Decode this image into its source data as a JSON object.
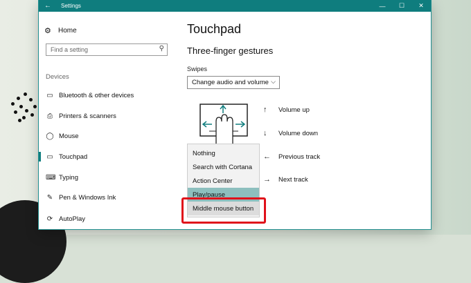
{
  "window": {
    "title": "Settings"
  },
  "titlebar": {
    "back_glyph": "←",
    "minimize_glyph": "—",
    "maximize_glyph": "☐",
    "close_glyph": "✕"
  },
  "sidebar": {
    "home_label": "Home",
    "search_placeholder": "Find a setting",
    "group_label": "Devices",
    "items": [
      {
        "label": "Bluetooth & other devices",
        "icon": "bluetooth-icon"
      },
      {
        "label": "Printers & scanners",
        "icon": "printer-icon"
      },
      {
        "label": "Mouse",
        "icon": "mouse-icon"
      },
      {
        "label": "Touchpad",
        "icon": "touchpad-icon",
        "active": true
      },
      {
        "label": "Typing",
        "icon": "keyboard-icon"
      },
      {
        "label": "Pen & Windows Ink",
        "icon": "pen-icon"
      },
      {
        "label": "AutoPlay",
        "icon": "autoplay-icon"
      }
    ]
  },
  "main": {
    "page_title": "Touchpad",
    "section_title": "Three-finger gestures",
    "swipes_label": "Swipes",
    "swipes_value": "Change audio and volume",
    "actions": [
      {
        "arrow": "↑",
        "label": "Volume up"
      },
      {
        "arrow": "↓",
        "label": "Volume down"
      },
      {
        "arrow": "←",
        "label": "Previous track"
      },
      {
        "arrow": "→",
        "label": "Next track"
      }
    ]
  },
  "popup": {
    "items": [
      {
        "label": "Nothing"
      },
      {
        "label": "Search with Cortana"
      },
      {
        "label": "Action Center"
      },
      {
        "label": "Play/pause",
        "selected": true
      },
      {
        "label": "Middle mouse button",
        "highlighted": true
      }
    ]
  },
  "colors": {
    "accent": "#0f7d7e",
    "selected": "#8dbfbe",
    "highlight_box": "#e0101a"
  }
}
